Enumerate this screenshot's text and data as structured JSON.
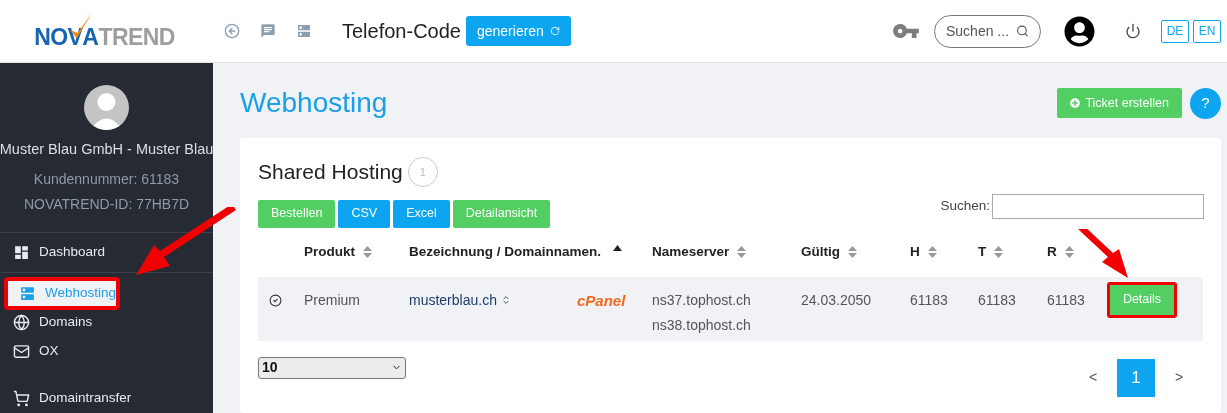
{
  "header": {
    "logo": [
      {
        "text": "NO",
        "kind": "blue"
      },
      {
        "text": "V",
        "kind": "check"
      },
      {
        "text": "A",
        "kind": "blue"
      },
      {
        "text": "TREND",
        "kind": "gray"
      }
    ],
    "phone_code": {
      "label": "Telefon-Code",
      "button": "generieren"
    },
    "search": {
      "placeholder": "Suchen ..."
    },
    "languages": [
      {
        "label": "DE",
        "selected": false
      },
      {
        "label": "EN",
        "selected": false
      }
    ]
  },
  "sidebar": {
    "user": {
      "name": "Muster Blau GmbH - Muster Blau",
      "customer_number_label": "Kundennummer:",
      "customer_number": "61183",
      "id_label": "NOVATREND-ID:",
      "id": "77HB7D"
    },
    "items": [
      {
        "label": "Dashboard",
        "kind": "dashboard",
        "selected": false,
        "highlighted": false
      },
      {
        "label": "Webhosting",
        "kind": "server",
        "selected": true,
        "highlighted": true
      },
      {
        "label": "Domains",
        "kind": "globe",
        "selected": false,
        "highlighted": false
      },
      {
        "label": "OX",
        "kind": "mail",
        "selected": false,
        "highlighted": false
      },
      {
        "label": "Domaintransfer",
        "kind": "cart",
        "selected": false,
        "highlighted": false
      }
    ]
  },
  "page": {
    "title": "Webhosting",
    "ticket_button": "Ticket erstellen",
    "help_button": "?"
  },
  "card": {
    "title": "Shared Hosting",
    "count": "1",
    "buttons": [
      {
        "label": "Bestellen",
        "kind": "green"
      },
      {
        "label": "CSV",
        "kind": "blue"
      },
      {
        "label": "Excel",
        "kind": "blue"
      },
      {
        "label": "Detailansicht",
        "kind": "green"
      }
    ],
    "search_label": "Suchen:",
    "table": {
      "columns": [
        {
          "label": "Produkt",
          "sorted": false
        },
        {
          "label": "Bezeichnung / Domainnamen.",
          "sorted": true
        },
        {
          "label": "Nameserver",
          "sorted": false
        },
        {
          "label": "Gültig",
          "sorted": false
        },
        {
          "label": "H",
          "sorted": false
        },
        {
          "label": "T",
          "sorted": false
        },
        {
          "label": "R",
          "sorted": false
        }
      ],
      "rows": [
        {
          "product": "Premium",
          "domain": "musterblau.ch",
          "panel": "cPanel",
          "nameservers": [
            "ns37.tophost.ch",
            "ns38.tophost.ch"
          ],
          "valid": "24.03.2050",
          "h": "61183",
          "t": "61183",
          "r": "61183",
          "action": "Details",
          "highlighted": true
        }
      ]
    },
    "page_size": "10",
    "pagination": [
      {
        "label": "<",
        "kind": "prev",
        "selected": false
      },
      {
        "label": "1",
        "kind": "page",
        "selected": true
      },
      {
        "label": ">",
        "kind": "next",
        "selected": false
      }
    ]
  }
}
